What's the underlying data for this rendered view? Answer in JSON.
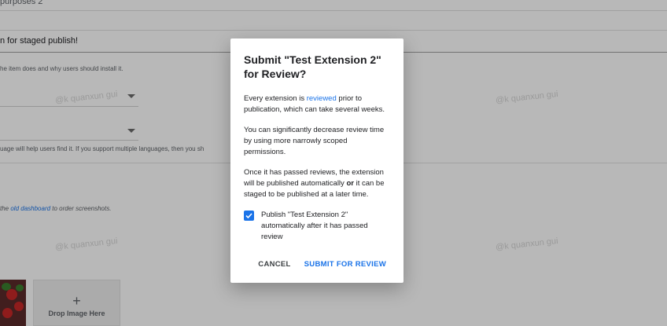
{
  "background": {
    "field_partial": "purposes 2",
    "staged_text": "n for staged publish!",
    "description_hint": "he item does and why users should install it.",
    "language_hint": "uage will help users find it. If you support multiple languages, then you sh",
    "screenshots_hint_prefix": "the ",
    "screenshots_hint_link": "old dashboard",
    "screenshots_hint_suffix": " to order screenshots.",
    "drop_plus": "+",
    "drop_label": "Drop Image Here",
    "watermark": "@k quanxun gui"
  },
  "dialog": {
    "title": "Submit \"Test Extension 2\" for Review?",
    "p1_before": "Every extension is ",
    "p1_link": "reviewed",
    "p1_after": " prior to publication, which can take several weeks.",
    "p2": "You can significantly decrease review time by using more narrowly scoped permissions.",
    "p3_before": "Once it has passed reviews, the extension will be published automatically ",
    "p3_bold": "or",
    "p3_after": " it can be staged to be published at a later time.",
    "checkbox_label": "Publish \"Test Extension 2\" automatically after it has passed review",
    "checkbox_checked": true,
    "cancel_label": "CANCEL",
    "submit_label": "SUBMIT FOR REVIEW"
  },
  "colors": {
    "accent": "#1a73e8",
    "scrim": "rgba(0,0,0,0.28)"
  }
}
